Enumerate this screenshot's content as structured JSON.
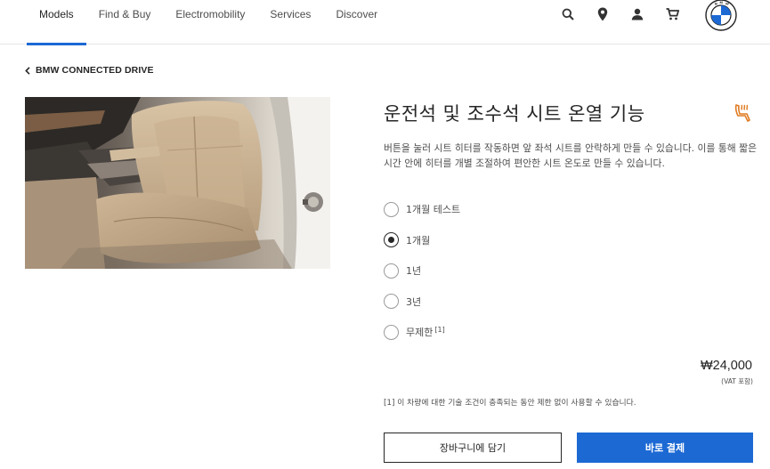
{
  "header": {
    "nav_items": [
      {
        "label": "Models",
        "active": true
      },
      {
        "label": "Find & Buy",
        "active": false
      },
      {
        "label": "Electromobility",
        "active": false
      },
      {
        "label": "Services",
        "active": false
      },
      {
        "label": "Discover",
        "active": false
      }
    ],
    "icons": [
      "search-icon",
      "location-pin-icon",
      "user-icon",
      "cart-icon"
    ],
    "logo_letters": "BMW"
  },
  "back": {
    "label": "BMW CONNECTED DRIVE"
  },
  "product": {
    "title": "운전석 및 조수석 시트 온열 기능",
    "description": "버튼을 눌러 시트 히터를 작동하면 앞 좌석 시트를 안락하게 만들 수 있습니다. 이를 통해 짧은 시간 안에 히터를 개별 조절하여 편안한 시트 온도로 만들 수 있습니다.",
    "options": [
      {
        "label": "1개월 테스트",
        "checked": false,
        "note": ""
      },
      {
        "label": "1개월",
        "checked": true,
        "note": ""
      },
      {
        "label": "1년",
        "checked": false,
        "note": ""
      },
      {
        "label": "3년",
        "checked": false,
        "note": ""
      },
      {
        "label": "무제한",
        "checked": false,
        "note": "[1]"
      }
    ],
    "price": "₩24,000",
    "price_note": "(VAT 포함)",
    "footnote": "[1] 이 차량에 대한 기술 조건이 충족되는 동안 제한 없이 사용할 수 있습니다.",
    "add_to_cart_label": "장바구니에 담기",
    "buy_now_label": "바로 결제"
  },
  "colors": {
    "accent": "#1c69d4",
    "text": "#262626",
    "seat_icon": "#e07b22"
  }
}
